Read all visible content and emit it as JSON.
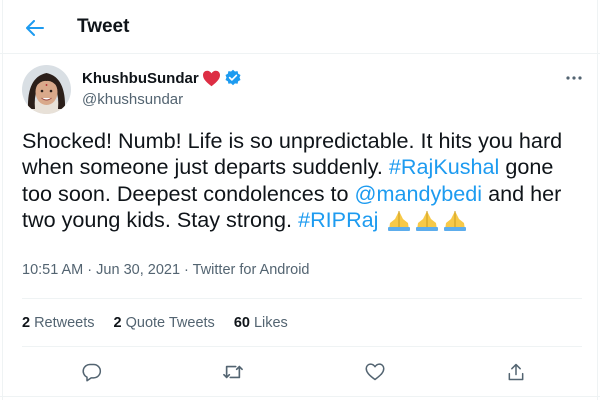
{
  "header": {
    "title": "Tweet",
    "back_icon": "arrow-left-icon",
    "accent": "#1d9bf0"
  },
  "author": {
    "display_name": "KhushbuSundar",
    "handle": "@khushsundar",
    "badges": [
      "red-heart-icon",
      "verified-badge-icon"
    ],
    "verified_color": "#1d9bf0",
    "heart_color": "#e0245e"
  },
  "tweet": {
    "t1": "Shocked! Numb! Life is so unpredictable. It hits you hard when someone just departs suddenly. ",
    "hashtag1": "#RajKushal",
    "t2": " gone too soon. Deepest condolences to ",
    "mention": "@mandybedi",
    "t3": " and her two young kids. Stay strong. ",
    "hashtag2": "#RIPRaj",
    "emoji": [
      "folded-hands-icon",
      "folded-hands-icon",
      "folded-hands-icon"
    ]
  },
  "meta": {
    "time": "10:51 AM",
    "sep1": " · ",
    "date": "Jun 30, 2021",
    "sep2": " · ",
    "source": "Twitter for Android"
  },
  "stats": {
    "retweets_count": "2",
    "retweets_label": "Retweets",
    "quotes_count": "2",
    "quotes_label": "Quote Tweets",
    "likes_count": "60",
    "likes_label": "Likes"
  },
  "actions": [
    "reply-icon",
    "retweet-icon",
    "like-icon",
    "share-icon"
  ],
  "colors": {
    "link": "#1d9bf0",
    "secondary_text": "#536471",
    "text": "#0f1419",
    "border": "#eff3f4"
  }
}
